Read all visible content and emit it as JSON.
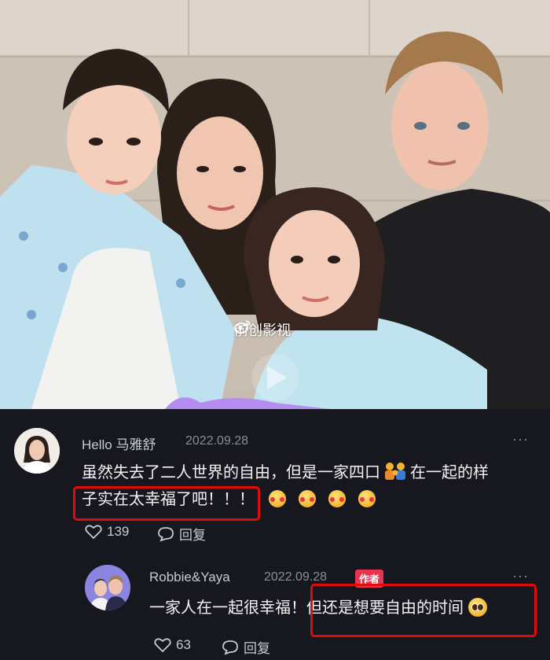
{
  "photo": {
    "watermark": "前创影视",
    "watermark_icon": "weibo-icon"
  },
  "comments": [
    {
      "username": "Hello 马雅舒",
      "date": "2022.09.28",
      "more": "···",
      "line1": "虽然失去了二人世界的自由，但是一家四口",
      "line1_emoji": "family-emoji",
      "line1_tail": "在一起的样",
      "line2": "子实在太幸福了吧！！！",
      "line2_emoji_count": 4,
      "likes": "139",
      "reply_label": "回复"
    },
    {
      "username": "Robbie&Yaya",
      "date": "2022.09.28",
      "badge": "作者",
      "more": "···",
      "text": "一家人在一起很幸福！但还是想要自由的时间",
      "text_emoji": "pleading-face-emoji",
      "likes": "63",
      "reply_label": "回复"
    }
  ],
  "colors": {
    "background": "#17171f",
    "highlight_box": "#e00c0c",
    "author_badge": "#e8344e"
  }
}
